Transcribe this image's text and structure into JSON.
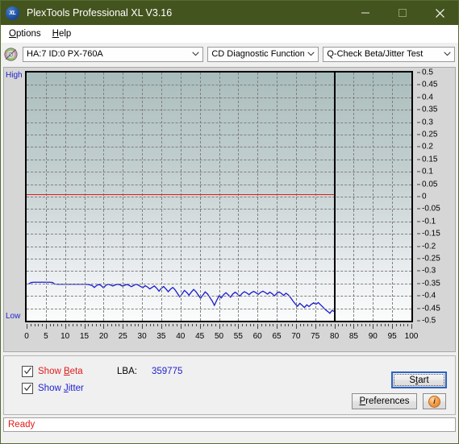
{
  "window": {
    "title": "PlexTools Professional XL V3.16",
    "app_icon": "XL",
    "minimize_icon": "minimize-icon",
    "maximize_icon": "maximize-icon",
    "close_icon": "close-icon"
  },
  "menubar": {
    "items": [
      {
        "label": "Options",
        "accel": "O"
      },
      {
        "label": "Help",
        "accel": "H"
      }
    ]
  },
  "toolbar": {
    "disc_icon": "cd-disc-icon",
    "drive_combo": {
      "value": "HA:7 ID:0  PX-760A"
    },
    "function_combo": {
      "value": "CD Diagnostic Functions"
    },
    "test_combo": {
      "value": "Q-Check Beta/Jitter Test"
    }
  },
  "chart_data": {
    "type": "line",
    "title": "",
    "xlabel": "",
    "ylabel": "",
    "xlim": [
      0,
      100
    ],
    "ylim": [
      -0.5,
      0.5
    ],
    "grid": true,
    "legend": "none",
    "left_axis_top_label": "High",
    "left_axis_bottom_label": "Low",
    "x_ticks": [
      0,
      5,
      10,
      15,
      20,
      25,
      30,
      35,
      40,
      45,
      50,
      55,
      60,
      65,
      70,
      75,
      80,
      85,
      90,
      95,
      100
    ],
    "y_ticks": [
      0.5,
      0.45,
      0.4,
      0.35,
      0.3,
      0.25,
      0.2,
      0.15,
      0.1,
      0.05,
      0,
      -0.05,
      -0.1,
      -0.15,
      -0.2,
      -0.25,
      -0.3,
      -0.35,
      -0.4,
      -0.45,
      -0.5
    ],
    "data_end_x": 80,
    "series": [
      {
        "name": "Beta",
        "color": "#e01b1b",
        "type": "constant",
        "value": 0.01,
        "x_range": [
          0,
          80
        ]
      },
      {
        "name": "Jitter",
        "color": "#1a1ad0",
        "type": "line",
        "x": [
          0.5,
          1.2,
          2,
          3,
          4,
          5,
          6,
          6.8,
          7.2,
          8,
          9,
          10,
          11,
          12,
          13,
          14,
          15,
          16,
          17,
          17.6,
          18.2,
          18.8,
          19.4,
          20,
          20.6,
          21.2,
          21.8,
          22.4,
          23,
          23.6,
          24.2,
          24.8,
          25.4,
          26,
          26.6,
          27.2,
          27.8,
          28.4,
          29,
          29.6,
          30.2,
          30.8,
          31.4,
          32,
          32.6,
          33.2,
          33.8,
          34.4,
          35,
          35.6,
          36.2,
          36.8,
          37.4,
          38,
          38.6,
          39.2,
          39.8,
          40.4,
          41,
          41.6,
          42.2,
          42.8,
          43.4,
          44,
          44.6,
          45.2,
          45.8,
          46.4,
          47,
          47.6,
          48.2,
          48.8,
          49.4,
          50,
          50.6,
          51.2,
          51.8,
          52.4,
          53,
          53.6,
          54.2,
          54.8,
          55.4,
          56,
          56.6,
          57.2,
          57.8,
          58.4,
          59,
          59.6,
          60.2,
          60.8,
          61.4,
          62,
          62.6,
          63.2,
          63.8,
          64.4,
          65,
          65.6,
          66.2,
          66.8,
          67.4,
          68,
          68.6,
          69.2,
          69.8,
          70.4,
          71,
          71.6,
          72.2,
          72.8,
          73.4,
          74,
          74.6,
          75.2,
          75.8,
          76.4,
          77,
          77.6,
          78.2,
          78.8,
          79.4,
          79.9
        ],
        "y": [
          -0.352,
          -0.346,
          -0.345,
          -0.345,
          -0.345,
          -0.345,
          -0.345,
          -0.346,
          -0.352,
          -0.353,
          -0.353,
          -0.353,
          -0.353,
          -0.353,
          -0.353,
          -0.353,
          -0.353,
          -0.354,
          -0.358,
          -0.366,
          -0.358,
          -0.354,
          -0.359,
          -0.368,
          -0.357,
          -0.353,
          -0.356,
          -0.36,
          -0.356,
          -0.353,
          -0.355,
          -0.36,
          -0.358,
          -0.354,
          -0.357,
          -0.363,
          -0.358,
          -0.353,
          -0.356,
          -0.362,
          -0.367,
          -0.359,
          -0.364,
          -0.372,
          -0.366,
          -0.36,
          -0.369,
          -0.381,
          -0.37,
          -0.362,
          -0.372,
          -0.383,
          -0.373,
          -0.366,
          -0.376,
          -0.39,
          -0.404,
          -0.392,
          -0.378,
          -0.386,
          -0.397,
          -0.385,
          -0.374,
          -0.383,
          -0.396,
          -0.41,
          -0.397,
          -0.384,
          -0.392,
          -0.406,
          -0.42,
          -0.438,
          -0.418,
          -0.4,
          -0.408,
          -0.395,
          -0.387,
          -0.396,
          -0.405,
          -0.392,
          -0.385,
          -0.392,
          -0.401,
          -0.39,
          -0.383,
          -0.388,
          -0.395,
          -0.387,
          -0.382,
          -0.387,
          -0.394,
          -0.386,
          -0.381,
          -0.386,
          -0.393,
          -0.385,
          -0.391,
          -0.4,
          -0.39,
          -0.384,
          -0.39,
          -0.398,
          -0.389,
          -0.396,
          -0.407,
          -0.42,
          -0.432,
          -0.442,
          -0.43,
          -0.438,
          -0.447,
          -0.436,
          -0.443,
          -0.434,
          -0.428,
          -0.434,
          -0.427,
          -0.436,
          -0.445,
          -0.455,
          -0.462,
          -0.47,
          -0.458,
          -0.463
        ]
      }
    ]
  },
  "controls": {
    "show_beta": {
      "label_prefix": "Show ",
      "accel": "B",
      "label_suffix": "eta",
      "checked": true,
      "color": "#e01b1b"
    },
    "show_jitter": {
      "label_prefix": "Show ",
      "accel": "J",
      "label_suffix": "itter",
      "checked": true,
      "color": "#2222cc"
    },
    "lba_label": "LBA:",
    "lba_value": "359775",
    "start_button": {
      "label_prefix": "S",
      "accel": "t",
      "label_suffix": "art",
      "full": "Start"
    },
    "preferences_button": {
      "accel": "P",
      "label_suffix": "references",
      "full": "Preferences"
    },
    "info_button": {
      "icon": "info-icon",
      "glyph": "i"
    }
  },
  "statusbar": {
    "text": "Ready"
  }
}
